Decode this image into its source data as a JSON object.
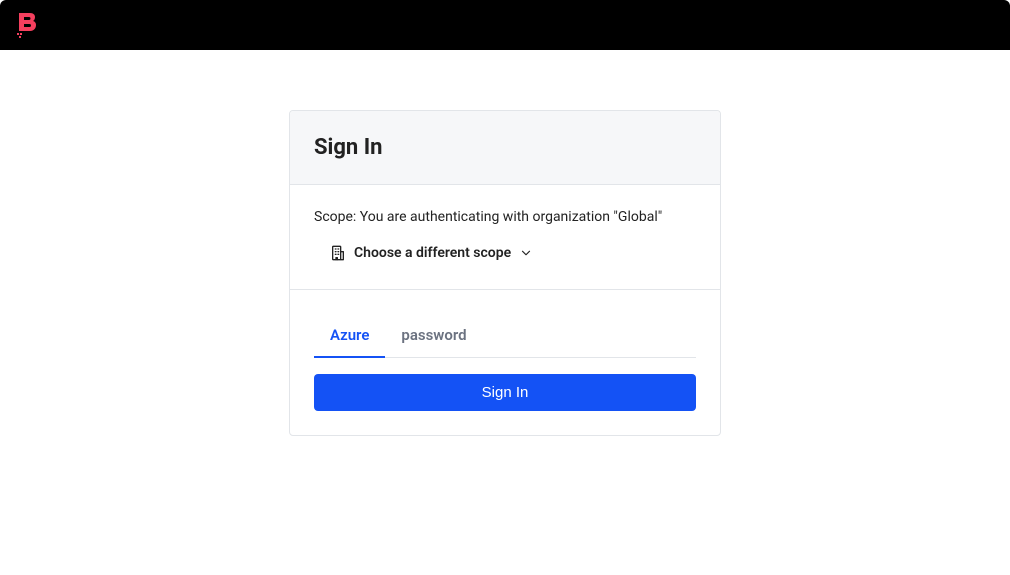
{
  "header": {
    "logo_name": "app-logo"
  },
  "card": {
    "title": "Sign In",
    "scope_text": "Scope: You are authenticating with organization \"Global\"",
    "scope_link_label": "Choose a different scope",
    "tabs": [
      {
        "label": "Azure",
        "active": true
      },
      {
        "label": "password",
        "active": false
      }
    ],
    "signin_button_label": "Sign In"
  },
  "colors": {
    "accent": "#1452f5",
    "logo": "#f43f5e",
    "header_bg": "#000000"
  }
}
